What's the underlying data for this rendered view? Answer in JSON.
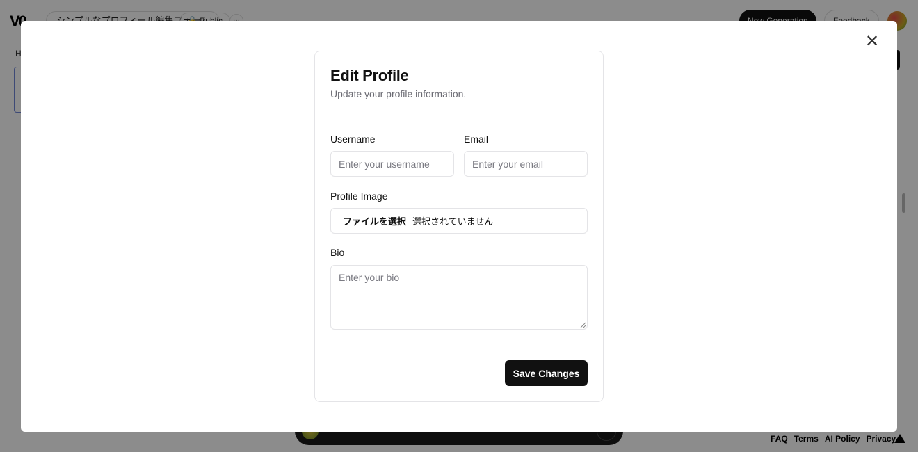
{
  "background": {
    "logo": "V0",
    "project_title": "シンプルなプロフィール編集フォーム",
    "visibility": "Public",
    "more": "···",
    "new_generation": "New Generation",
    "feedback": "Feedback",
    "side_letter": "H",
    "footer_links": [
      "FAQ",
      "Terms",
      "AI Policy",
      "Privacy"
    ]
  },
  "modal": {
    "close_glyph": "✕",
    "card": {
      "title": "Edit Profile",
      "subtitle": "Update your profile information.",
      "username": {
        "label": "Username",
        "placeholder": "Enter your username",
        "value": ""
      },
      "email": {
        "label": "Email",
        "placeholder": "Enter your email",
        "value": ""
      },
      "profile_image": {
        "label": "Profile Image",
        "button": "ファイルを選択",
        "status": "選択されていません"
      },
      "bio": {
        "label": "Bio",
        "placeholder": "Enter your bio",
        "value": ""
      },
      "save_label": "Save Changes"
    }
  },
  "colors": {
    "primary": "#111111",
    "border": "#e4e4e7",
    "muted_text": "#6b6b73"
  }
}
